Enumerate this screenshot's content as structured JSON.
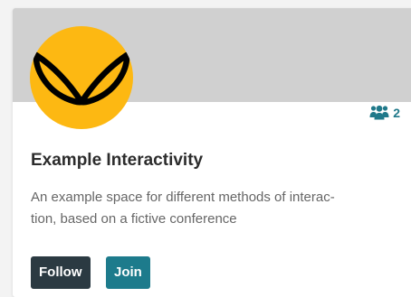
{
  "space": {
    "members_count": "2",
    "members_icon": "users-icon",
    "logo_icon": "leaf-sprout-logo-icon",
    "title": "Example Interactivity",
    "description_lines": [
      "An example space for different methods of interac-",
      "tion, based on a fictive conference"
    ]
  },
  "actions": {
    "follow_label": "Follow",
    "join_label": "Join"
  },
  "colors": {
    "banner": "#d0d0d0",
    "logo_bg": "#fdb812",
    "accent": "#1d7b8c",
    "follow_button": "#2b3a42"
  }
}
